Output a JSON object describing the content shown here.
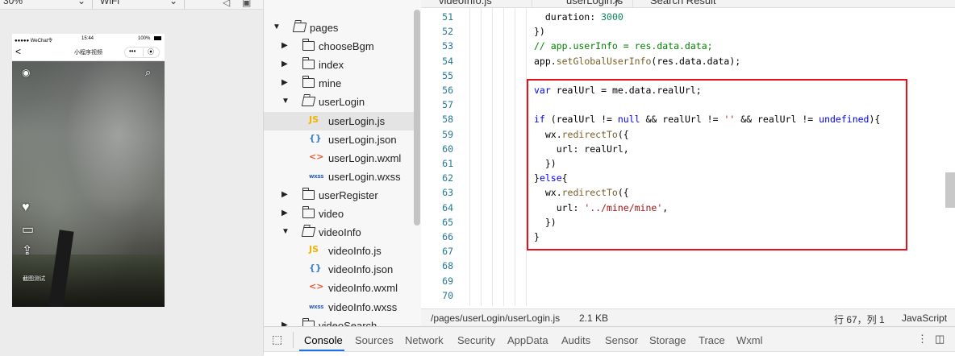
{
  "toolbar": {
    "zoom": "30%",
    "network": "WiFi"
  },
  "phone": {
    "carrier": "●●●●● WeChat令",
    "time": "15:44",
    "battery": "100%",
    "nav_back": "<",
    "nav_title": "小程序视频",
    "capsule_menu": "•••",
    "capsule_close": "⦿",
    "side_label": "截图测试"
  },
  "file_tree": {
    "items": [
      {
        "label": "pages",
        "kind": "folder",
        "open": true,
        "depth": 0
      },
      {
        "label": "chooseBgm",
        "kind": "folder",
        "open": false,
        "depth": 1
      },
      {
        "label": "index",
        "kind": "folder",
        "open": false,
        "depth": 1
      },
      {
        "label": "mine",
        "kind": "folder",
        "open": false,
        "depth": 1
      },
      {
        "label": "userLogin",
        "kind": "folder",
        "open": true,
        "depth": 1
      },
      {
        "label": "userLogin.js",
        "kind": "js",
        "icon": "JS",
        "depth": 2,
        "selected": true
      },
      {
        "label": "userLogin.json",
        "kind": "json",
        "icon": "{}",
        "depth": 2
      },
      {
        "label": "userLogin.wxml",
        "kind": "wxml",
        "icon": "<>",
        "depth": 2
      },
      {
        "label": "userLogin.wxss",
        "kind": "wxss",
        "icon": "wxss",
        "depth": 2
      },
      {
        "label": "userRegister",
        "kind": "folder",
        "open": false,
        "depth": 1
      },
      {
        "label": "video",
        "kind": "folder",
        "open": false,
        "depth": 1
      },
      {
        "label": "videoInfo",
        "kind": "folder",
        "open": true,
        "depth": 1
      },
      {
        "label": "videoInfo.js",
        "kind": "js",
        "icon": "JS",
        "depth": 2
      },
      {
        "label": "videoInfo.json",
        "kind": "json",
        "icon": "{}",
        "depth": 2
      },
      {
        "label": "videoInfo.wxml",
        "kind": "wxml",
        "icon": "<>",
        "depth": 2
      },
      {
        "label": "videoInfo.wxss",
        "kind": "wxss",
        "icon": "wxss",
        "depth": 2
      },
      {
        "label": "videoSearch",
        "kind": "folder",
        "open": false,
        "depth": 1
      }
    ]
  },
  "editor": {
    "tabs": [
      {
        "label": "videoInfo.js"
      },
      {
        "label": "userLogin.js",
        "close": "×"
      },
      {
        "label": "Search Result"
      }
    ],
    "line_numbers": [
      "51",
      "52",
      "53",
      "54",
      "55",
      "56",
      "57",
      "58",
      "59",
      "60",
      "61",
      "62",
      "63",
      "64",
      "65",
      "66",
      "67",
      "68",
      "69",
      "70"
    ],
    "code": [
      [
        {
          "t": "  duration: "
        },
        {
          "t": "3000",
          "c": "num"
        }
      ],
      [
        {
          "t": "})"
        }
      ],
      [
        {
          "t": "// app.userInfo = res.data.data;",
          "c": "cm"
        }
      ],
      [
        {
          "t": "app."
        },
        {
          "t": "setGlobalUserInfo",
          "c": "fn"
        },
        {
          "t": "(res.data.data);"
        }
      ],
      [],
      [
        {
          "t": "var",
          "c": "kw"
        },
        {
          "t": " realUrl = me.data.realUrl;"
        }
      ],
      [],
      [
        {
          "t": "if",
          "c": "kw"
        },
        {
          "t": " (realUrl != "
        },
        {
          "t": "null",
          "c": "kw"
        },
        {
          "t": " && realUrl != "
        },
        {
          "t": "''",
          "c": "str"
        },
        {
          "t": " && realUrl != "
        },
        {
          "t": "undefined",
          "c": "kw"
        },
        {
          "t": "){"
        }
      ],
      [
        {
          "t": "  wx."
        },
        {
          "t": "redirectTo",
          "c": "fn"
        },
        {
          "t": "({"
        }
      ],
      [
        {
          "t": "    url: realUrl,"
        }
      ],
      [
        {
          "t": "  })"
        }
      ],
      [
        {
          "t": "}"
        },
        {
          "t": "else",
          "c": "kw"
        },
        {
          "t": "{"
        }
      ],
      [
        {
          "t": "  wx."
        },
        {
          "t": "redirectTo",
          "c": "fn"
        },
        {
          "t": "({"
        }
      ],
      [
        {
          "t": "    url: "
        },
        {
          "t": "'../mine/mine'",
          "c": "str"
        },
        {
          "t": ","
        }
      ],
      [
        {
          "t": "  })"
        }
      ],
      [
        {
          "t": "}"
        }
      ],
      [],
      [],
      [],
      []
    ]
  },
  "status_bar": {
    "path": "/pages/userLogin/userLogin.js",
    "size": "2.1 KB",
    "cursor": "行 67，列 1",
    "language": "JavaScript"
  },
  "devtools": {
    "tabs": [
      "Console",
      "Sources",
      "Network",
      "Security",
      "AppData",
      "Audits",
      "Sensor",
      "Storage",
      "Trace",
      "Wxml"
    ],
    "active": "Console"
  },
  "colors": {
    "highlight": "#e5121c",
    "keyword": "#0000ff",
    "string": "#a31515",
    "number": "#098658",
    "comment": "#008000"
  }
}
